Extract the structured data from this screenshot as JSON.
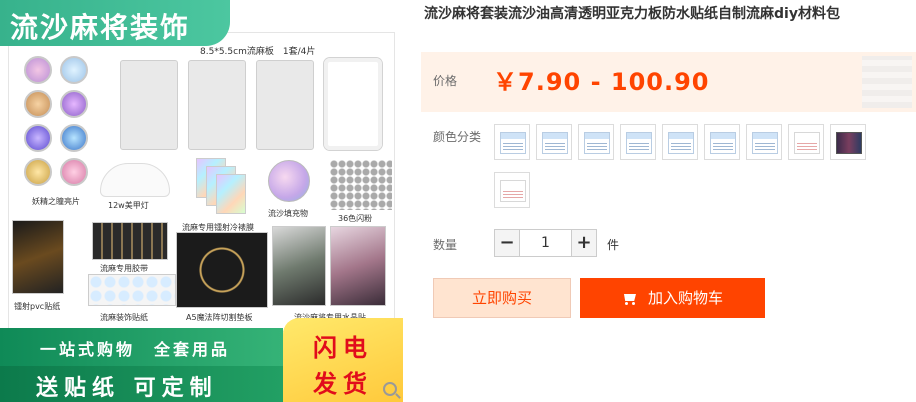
{
  "product_image": {
    "header": "流沙麻将装饰",
    "board_label": "8.5*5.5cm流麻板　1套/4片",
    "captions": {
      "sequins": "妖精之瞳亮片",
      "lamp": "12w美甲灯",
      "cold_film": "流麻专用镭射冷裱膜",
      "filler": "流沙填充物",
      "glitter": "36色闪粉",
      "pvc": "镭射pvc贴纸",
      "tape": "流麻专用胶带",
      "stickers": "流麻装饰贴纸",
      "mat": "A5魔法阵切割垫板",
      "crystal": "流沙麻将专用水晶贴"
    },
    "banner_top": "一站式购物　全套用品",
    "banner_bottom": "送贴纸 可定制",
    "flash_line1": "闪电",
    "flash_line2": "发货"
  },
  "product": {
    "title": "流沙麻将套装流沙油高清透明亚克力板防水贴纸自制流麻diy材料包",
    "price_label": "价格",
    "price": "￥7.90 - 100.90",
    "color_label": "颜色分类",
    "swatch_count": 10,
    "quantity_label": "数量",
    "quantity": "1",
    "minus": "−",
    "plus": "+",
    "unit": "件",
    "buy_now": "立即购买",
    "add_to_cart": "加入购物车",
    "accent": "#ff4400"
  }
}
